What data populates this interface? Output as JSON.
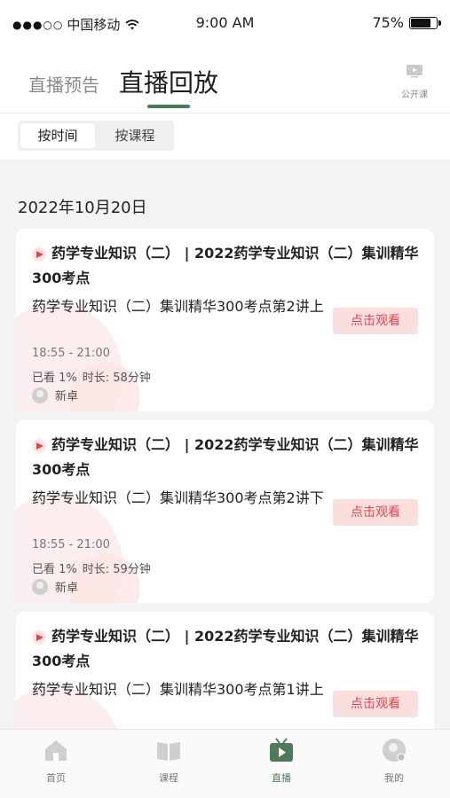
{
  "status_bar": {
    "carrier": "中国移动",
    "time": "9:00 AM",
    "battery": "75%"
  },
  "header": {
    "tab_preview": "直播预告",
    "tab_replay": "直播回放",
    "open_course_label": "公开课"
  },
  "segment": {
    "by_time": "按时间",
    "by_course": "按课程"
  },
  "date_group": "2022年10月20日",
  "lessons": [
    {
      "course": "药学专业知识（二） | 2022药学专业知识（二）集训精华300考点",
      "title": "药学专业知识（二）集训精华300考点第2讲上",
      "time": "18:55 - 21:00",
      "watched": "已看 1%",
      "duration": "时长: 58分钟",
      "teacher": "新卓",
      "button": "点击观看"
    },
    {
      "course": "药学专业知识（二） | 2022药学专业知识（二）集训精华300考点",
      "title": "药学专业知识（二）集训精华300考点第2讲下",
      "time": "18:55 - 21:00",
      "watched": "已看 1%",
      "duration": "时长: 59分钟",
      "teacher": "新卓",
      "button": "点击观看"
    },
    {
      "course": "药学专业知识（二） | 2022药学专业知识（二）集训精华300考点",
      "title": "药学专业知识（二）集训精华300考点第1讲上",
      "time": "",
      "watched": "",
      "duration": "",
      "teacher": "",
      "button": "点击观看"
    }
  ],
  "tabbar": {
    "home": "首页",
    "courses": "课程",
    "live": "直播",
    "mine": "我的"
  },
  "colors": {
    "accent_green": "#4f7a5a",
    "watch_red": "#e2464e",
    "watch_bg": "#fbdede"
  }
}
